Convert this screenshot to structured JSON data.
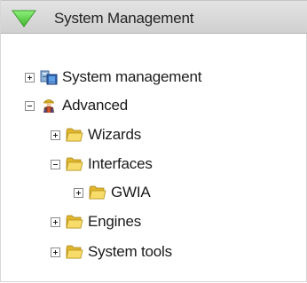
{
  "panel": {
    "title": "System Management",
    "header_color": "#d6d6d6",
    "arrow_color": "#5fd34a"
  },
  "tree": {
    "items": [
      {
        "label": "System management",
        "expander": "plus",
        "icon": "computer-icon"
      },
      {
        "label": "Advanced",
        "expander": "minus",
        "icon": "engineer-icon"
      },
      {
        "label": "Wizards",
        "expander": "plus",
        "icon": "folder-icon"
      },
      {
        "label": "Interfaces",
        "expander": "minus",
        "icon": "folder-icon"
      },
      {
        "label": "GWIA",
        "expander": "plus",
        "icon": "folder-icon"
      },
      {
        "label": "Engines",
        "expander": "plus",
        "icon": "folder-icon"
      },
      {
        "label": "System tools",
        "expander": "plus",
        "icon": "folder-icon"
      }
    ]
  }
}
